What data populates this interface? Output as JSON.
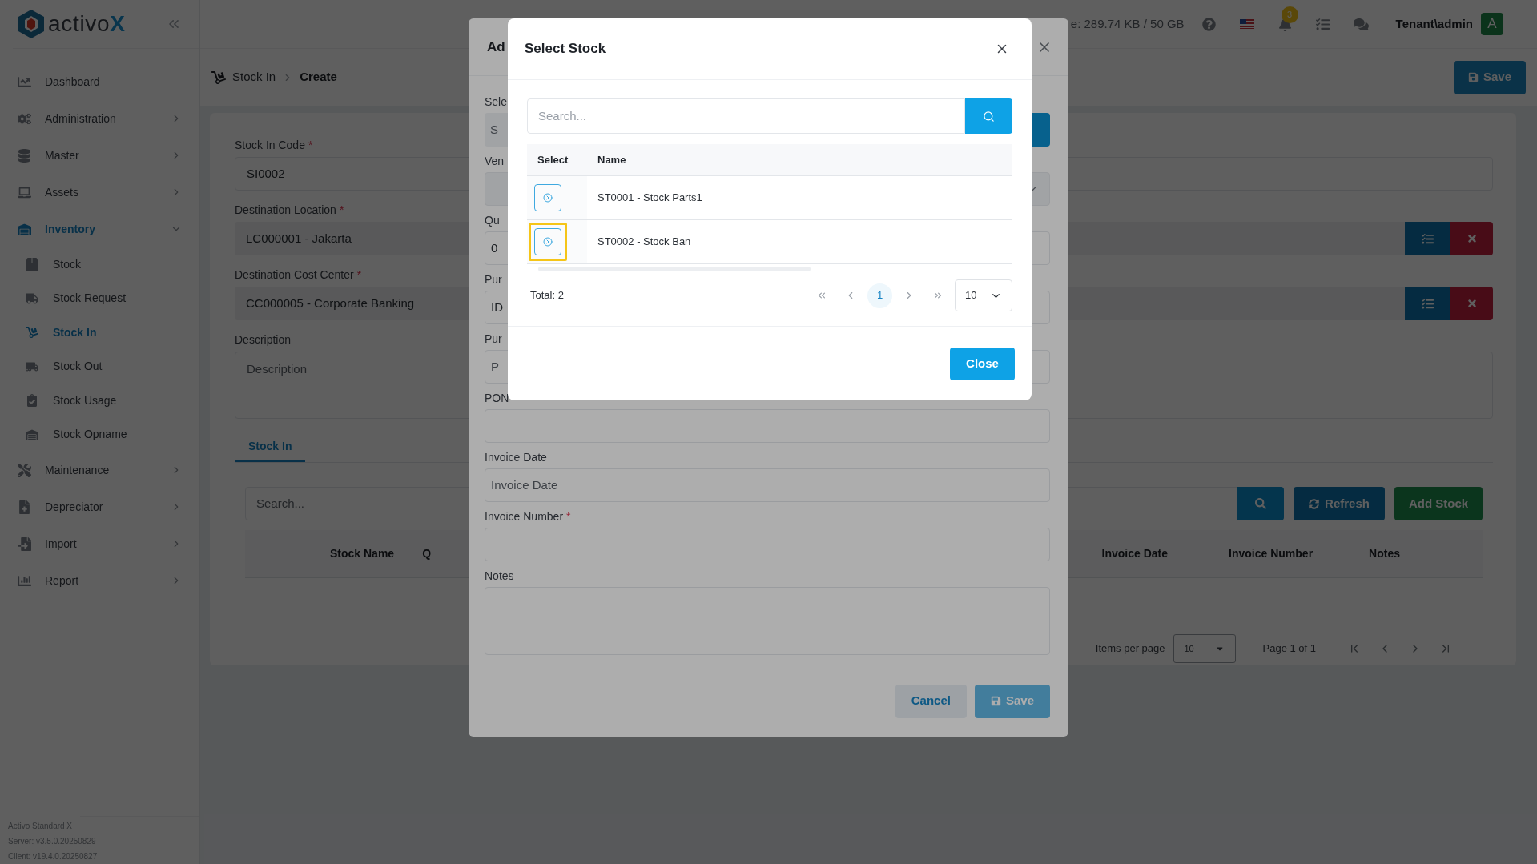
{
  "sidebar": {
    "logo": {
      "text": "activo",
      "accent": "X"
    },
    "menu": [
      {
        "label": "Dashboard",
        "kind": "link",
        "selected": false
      },
      {
        "label": "Administration",
        "kind": "group",
        "expanded": false,
        "selected": false
      },
      {
        "label": "Master",
        "kind": "group",
        "expanded": false,
        "selected": false
      },
      {
        "label": "Assets",
        "kind": "group",
        "expanded": false,
        "selected": false
      },
      {
        "label": "Inventory",
        "kind": "group",
        "expanded": true,
        "selected": true,
        "children": [
          {
            "label": "Stock",
            "selected": false
          },
          {
            "label": "Stock Request",
            "selected": false
          },
          {
            "label": "Stock In",
            "selected": true
          },
          {
            "label": "Stock Out",
            "selected": false
          },
          {
            "label": "Stock Usage",
            "selected": false
          },
          {
            "label": "Stock Opname",
            "selected": false
          }
        ]
      },
      {
        "label": "Maintenance",
        "kind": "group",
        "expanded": false,
        "selected": false
      },
      {
        "label": "Depreciator",
        "kind": "group",
        "expanded": false,
        "selected": false
      },
      {
        "label": "Import",
        "kind": "group",
        "expanded": false,
        "selected": false
      },
      {
        "label": "Report",
        "kind": "group",
        "expanded": false,
        "selected": false
      }
    ],
    "versions": [
      "Activo Standard X",
      "Server: v3.5.0.20250829",
      "Client: v19.4.0.20250827"
    ]
  },
  "topbar": {
    "storage": "e: 289.74 KB / 50 GB",
    "notification_count": "3",
    "user": "Tenant\\admin",
    "avatar": "A"
  },
  "page": {
    "breadcrumb": [
      "Stock In",
      "Create"
    ],
    "save": "Save",
    "fields": [
      {
        "label": "Stock In Code",
        "required_mark": "*",
        "kind": "text",
        "value": "SI0002"
      },
      {
        "label": "Destination Location",
        "required_mark": "*",
        "kind": "lookup",
        "value": "LC000001 - Jakarta"
      },
      {
        "label": "Destination Cost Center",
        "required_mark": "*",
        "kind": "lookup",
        "value": "CC000005 - Corporate Banking"
      },
      {
        "label": "Description",
        "kind": "textarea",
        "placeholder": "Description"
      }
    ],
    "tabs": [
      {
        "label": "Stock In",
        "selected": true
      }
    ],
    "search_placeholder": "Search...",
    "refresh": "Refresh",
    "add": "Add Stock",
    "columns": [
      "Stock Name",
      "Q",
      "Invoice Date",
      "Invoice Number",
      "Notes"
    ],
    "pagination": {
      "items_label": "Items per page",
      "per_page": "10",
      "page": "Page 1 of 1"
    }
  },
  "add_dialog": {
    "title": "Ad",
    "fields": [
      {
        "label": "Sele",
        "kind": "lookup",
        "placeholder": "S"
      },
      {
        "label": "Ven",
        "kind": "select"
      },
      {
        "label": "Qu",
        "kind": "text",
        "value": "0"
      },
      {
        "label": "Pur",
        "kind": "text",
        "value": "ID"
      },
      {
        "label": "Pur",
        "kind": "text",
        "placeholder": "P"
      },
      {
        "label": "PON",
        "kind": "text"
      },
      {
        "label": "Invoice Date",
        "kind": "text",
        "placeholder": "Invoice Date"
      },
      {
        "label": "Invoice Number",
        "required_mark": "*",
        "kind": "text"
      },
      {
        "label": "Notes",
        "kind": "textarea"
      }
    ],
    "cancel": "Cancel",
    "save": "Save"
  },
  "select_dialog": {
    "title": "Select Stock",
    "search_placeholder": "Search...",
    "columns": [
      "Select",
      "Name"
    ],
    "rows": [
      {
        "name": "ST0001 - Stock Parts1",
        "highlighted": false
      },
      {
        "name": "ST0002 - Stock Ban",
        "highlighted": true
      }
    ],
    "total": "Total: 2",
    "pages": [
      {
        "label": "1",
        "selected": true
      }
    ],
    "per_page": "10",
    "close": "Close"
  }
}
